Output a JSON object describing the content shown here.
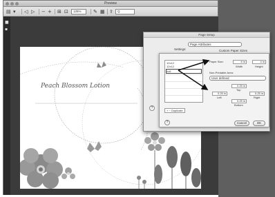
{
  "app": {
    "title": "Preview",
    "zoom": "125%",
    "search_placeholder": "Q"
  },
  "document": {
    "title": "Peach Blossom Lotion"
  },
  "dialog": {
    "title": "Page Setup",
    "settings_label": "Settings:",
    "settings_value": "Page Attributes",
    "section_label": "Custom Paper Sizes"
  },
  "custom_sizes": {
    "list_items": [
      "12x12",
      "12x12",
      "4x6"
    ],
    "paper_size_label": "Paper Size:",
    "width_value": "6 in",
    "height_value": "4 in",
    "width_label": "Width",
    "height_label": "Height",
    "non_printable_label": "Non-Printable Area:",
    "non_printable_value": "User defined",
    "top_value": "0.25 in",
    "top_label": "Top",
    "left_value": "0.25 in",
    "left_label": "Left",
    "right_value": "0.25 in",
    "right_label": "Right",
    "bottom_value": "0.25 in",
    "bottom_label": "Bottom",
    "duplicate_label": "Duplicate",
    "cancel_label": "Cancel",
    "ok_label": "OK",
    "help_label": "?"
  }
}
